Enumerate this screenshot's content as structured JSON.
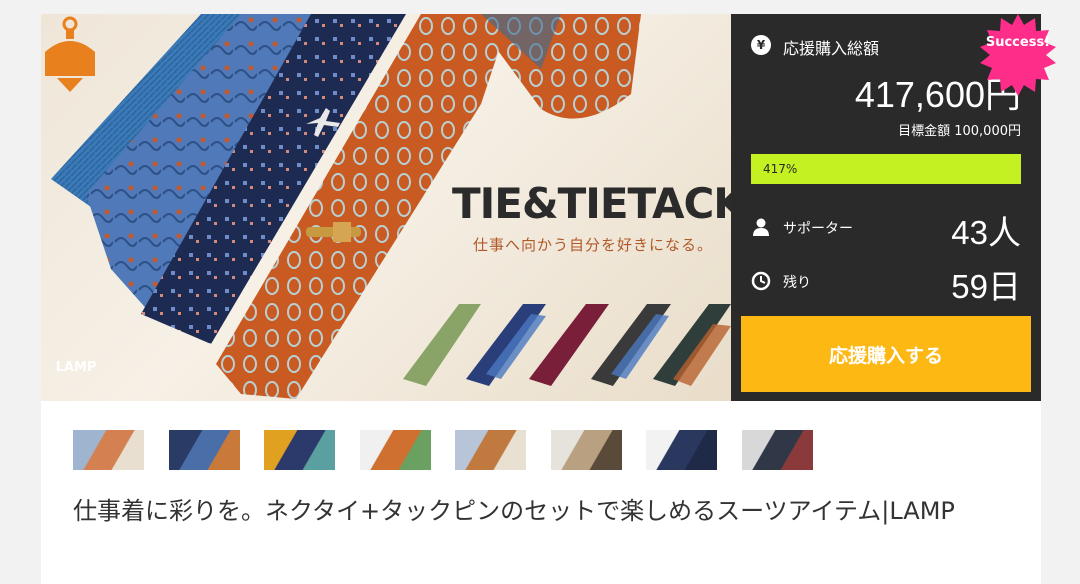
{
  "hero": {
    "title": "TIE&TIETACK",
    "subtitle": "仕事へ向かう自分を好きになる。",
    "logo_text": "LAMP"
  },
  "badge": {
    "text": "Success!",
    "color": "#ff2d8a"
  },
  "funding": {
    "total_label": "応援購入総額",
    "total_amount": "417,600円",
    "goal_text": "目標金額 100,000円",
    "percent_text": "417%",
    "progress_fraction": 1.0,
    "supporters_label": "サポーター",
    "supporters_value": "43人",
    "remaining_label": "残り",
    "remaining_value": "59日",
    "icons": {
      "total": "yen-icon",
      "supporters": "person-icon",
      "remaining": "clock-icon"
    }
  },
  "actions": {
    "support_button": "応援購入する"
  },
  "thumbnails": [
    {
      "name": "thumb-ties-package",
      "colors": [
        "#9fb4cf",
        "#d58050",
        "#e8dfd0"
      ]
    },
    {
      "name": "thumb-navy-tie",
      "colors": [
        "#2a3c66",
        "#4a6fa8",
        "#c97a3a"
      ]
    },
    {
      "name": "thumb-tie-assortment",
      "colors": [
        "#e0a020",
        "#2b3a6a",
        "#5aa0a0"
      ]
    },
    {
      "name": "thumb-tie-tack-closeup",
      "colors": [
        "#f0f0f0",
        "#d07030",
        "#6aa060"
      ]
    },
    {
      "name": "thumb-tie-pin-gold",
      "colors": [
        "#b8c4d8",
        "#c07a40",
        "#e8e0d0"
      ]
    },
    {
      "name": "thumb-man-beige-suit",
      "colors": [
        "#e6e2dc",
        "#b8a080",
        "#5a4a3a"
      ]
    },
    {
      "name": "thumb-man-navy-suit",
      "colors": [
        "#f2f2f2",
        "#2a3860",
        "#1e2a48"
      ]
    },
    {
      "name": "thumb-man-dark-suit",
      "colors": [
        "#d8d8d8",
        "#303848",
        "#8a3a3a"
      ]
    }
  ],
  "project": {
    "title": "仕事着に彩りを。ネクタイ+タックピンのセットで楽しめるスーツアイテム|LAMP"
  }
}
